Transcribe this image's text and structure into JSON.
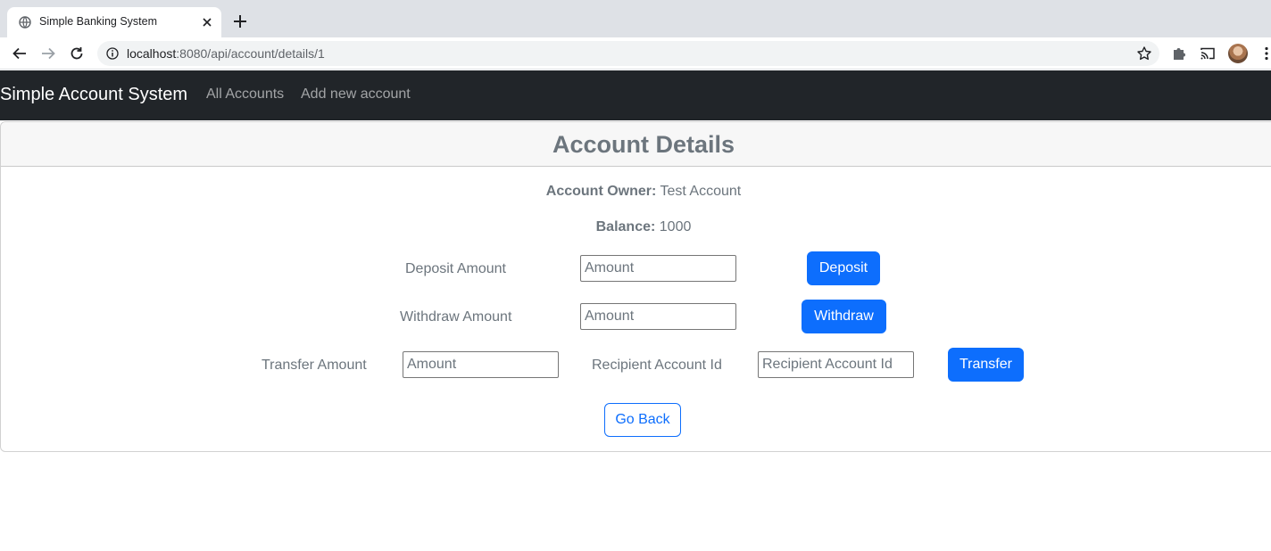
{
  "browser": {
    "tab_title": "Simple Banking System",
    "url_host": "localhost",
    "url_rest": ":8080/api/account/details/1"
  },
  "navbar": {
    "brand": "Simple Account System",
    "links": [
      "All Accounts",
      "Add new account"
    ]
  },
  "card": {
    "title": "Account Details",
    "owner_label": "Account Owner:",
    "owner_value": "Test Account",
    "balance_label": "Balance:",
    "balance_value": "1000"
  },
  "deposit": {
    "label": "Deposit Amount",
    "placeholder": "Amount",
    "button": "Deposit"
  },
  "withdraw": {
    "label": "Withdraw Amount",
    "placeholder": "Amount",
    "button": "Withdraw"
  },
  "transfer": {
    "label": "Transfer Amount",
    "placeholder": "Amount",
    "recipient_label": "Recipient Account Id",
    "recipient_placeholder": "Recipient Account Id",
    "button": "Transfer"
  },
  "go_back": "Go Back",
  "colors": {
    "navbar_bg": "#212529",
    "primary": "#0d6efd",
    "muted_text": "#6c757d",
    "chrome_bg": "#dee1e6"
  }
}
